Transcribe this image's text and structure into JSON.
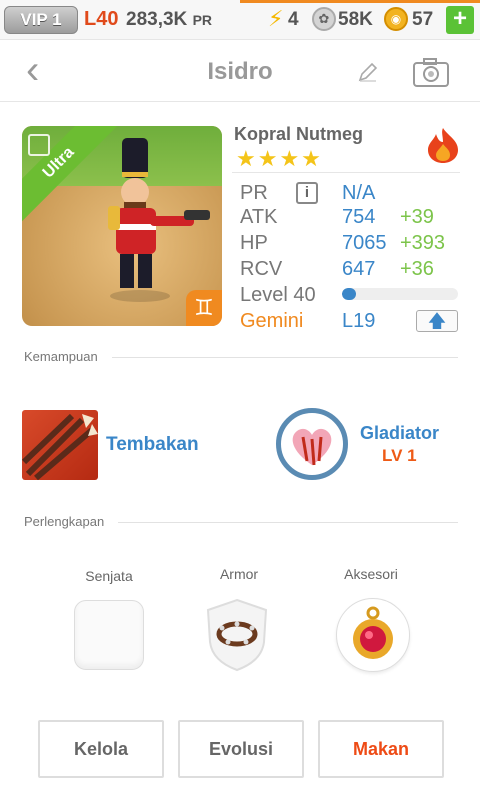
{
  "topbar": {
    "vip": "VIP 1",
    "level": "L40",
    "power": "283,3K",
    "power_unit": "PR",
    "energy": "4",
    "food": "58K",
    "gems": "57",
    "add": "+"
  },
  "header": {
    "title": "Isidro"
  },
  "character": {
    "badge": "Ultra",
    "name": "Kopral Nutmeg",
    "stars": "★★★★",
    "rarity_stars": 4,
    "zodiac_symbol": "♊",
    "stats": {
      "pr_label": "PR",
      "pr_value": "N/A",
      "atk_label": "ATK",
      "atk_value": "754",
      "atk_bonus": "+39",
      "hp_label": "HP",
      "hp_value": "7065",
      "hp_bonus": "+393",
      "rcv_label": "RCV",
      "rcv_value": "647",
      "rcv_bonus": "+36",
      "level_label": "Level 40",
      "level_progress": 0.12,
      "sign_label": "Gemini",
      "sign_level": "L19"
    }
  },
  "skills": {
    "section_title": "Kemampuan",
    "active": {
      "name": "Tembakan"
    },
    "leader": {
      "name": "Gladiator",
      "level": "LV 1"
    }
  },
  "equipment": {
    "section_title": "Perlengkapan",
    "weapon_label": "Senjata",
    "armor_label": "Armor",
    "accessory_label": "Aksesori"
  },
  "actions": {
    "manage": "Kelola",
    "evolve": "Evolusi",
    "feed": "Makan"
  },
  "colors": {
    "accent_blue": "#3a86c8",
    "bonus_green": "#7cc44a",
    "orange": "#f08a20",
    "red_action": "#ee4b16"
  }
}
